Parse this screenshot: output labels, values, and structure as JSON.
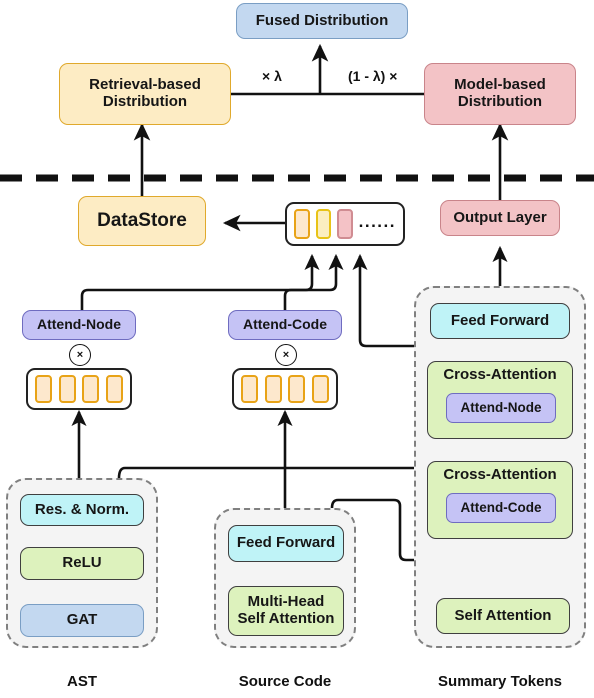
{
  "title": "Retrieval-augmented code summarization architecture",
  "colors": {
    "blue": "#c3d8f0",
    "blue_border": "#7a9ec4",
    "yellow": "#fdecc4",
    "yellow_border": "#e0a92c",
    "pink": "#f3c3c6",
    "pink_border": "#c9848a",
    "purple": "#c5c3f5",
    "purple_border": "#6f6cc0",
    "green": "#ddf2bd",
    "green_border": "#3f3f3f",
    "cyan": "#bff3f7",
    "cyan_border": "#3f3f3f",
    "token_fill": "#fde8cd",
    "token_border": "#e8a317",
    "token_fill_yellow": "#fbeec0",
    "token_border_yellow": "#e8c317",
    "token_fill_pink": "#f4c2c6",
    "token_border_pink": "#d08c92",
    "group_fill": "#f4f4f4",
    "group_border": "#808080",
    "wire": "#111111"
  },
  "top": {
    "fused": "Fused Distribution",
    "retrieval": "Retrieval-based\nDistribution",
    "retrieval_line1": "Retrieval-based",
    "retrieval_line2": "Distribution",
    "model": "Model-based\nDistribution",
    "model_line1": "Model-based",
    "model_line2": "Distribution",
    "lambda_left": "× λ",
    "lambda_right": "(1 - λ) ×"
  },
  "mid": {
    "datastore": "DataStore",
    "output_layer": "Output Layer",
    "retrieved_tokens": {
      "name": "retrieved-token-row",
      "dots": "......",
      "tokens": [
        {
          "fill": "#fde8cd",
          "border": "#e8a317"
        },
        {
          "fill": "#fbeec0",
          "border": "#e8c317"
        },
        {
          "fill": "#f4c2c6",
          "border": "#d08c92"
        }
      ]
    }
  },
  "attend": {
    "node": "Attend-Node",
    "code": "Attend-Code",
    "otimes": "×"
  },
  "representations": {
    "ast_tokens": 4,
    "code_tokens": 4
  },
  "groups": {
    "ast": {
      "caption": "AST",
      "blocks": [
        {
          "label": "Res. & Norm.",
          "color": "cyan"
        },
        {
          "label": "ReLU",
          "color": "green"
        },
        {
          "label": "GAT",
          "color": "blue"
        }
      ]
    },
    "source_code": {
      "caption": "Source Code",
      "blocks": [
        {
          "label": "Feed Forward",
          "color": "cyan"
        },
        {
          "label": "Multi-Head\nSelf Attention",
          "color": "green",
          "line1": "Multi-Head",
          "line2": "Self Attention"
        }
      ]
    },
    "summary_tokens": {
      "caption": "Summary Tokens",
      "blocks": [
        {
          "label": "Feed Forward",
          "color": "cyan"
        },
        {
          "label": "Cross-Attention",
          "color": "green",
          "badge": "Attend-Node"
        },
        {
          "label": "Cross-Attention",
          "color": "green",
          "badge": "Attend-Code"
        },
        {
          "label": "Self Attention",
          "color": "green"
        }
      ]
    }
  }
}
